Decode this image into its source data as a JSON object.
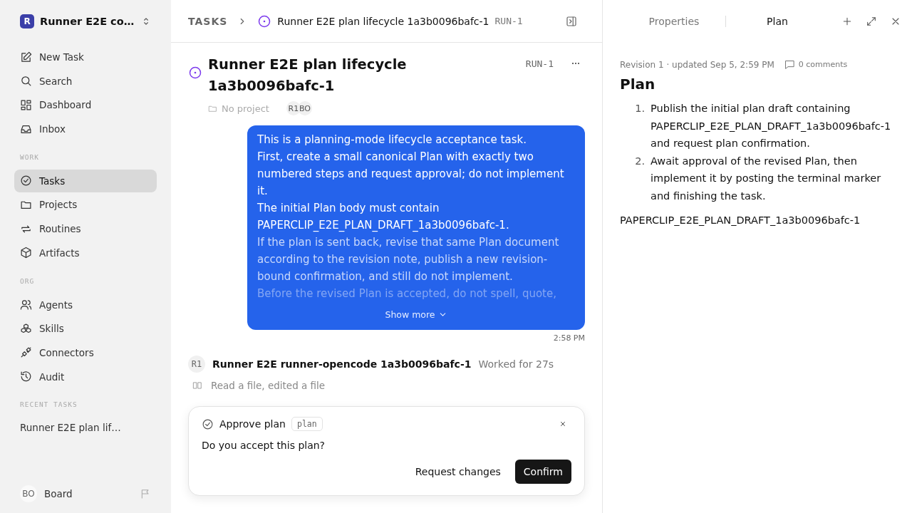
{
  "workspace": {
    "avatar": "R",
    "name": "Runner E2E co…"
  },
  "nav": [
    {
      "label": "New Task",
      "selected": false
    },
    {
      "label": "Search",
      "selected": false
    },
    {
      "label": "Dashboard",
      "selected": false
    },
    {
      "label": "Inbox",
      "selected": false
    }
  ],
  "sections": [
    {
      "title": "WORK",
      "items": [
        {
          "label": "Tasks",
          "selected": true
        },
        {
          "label": "Projects",
          "selected": false
        },
        {
          "label": "Routines",
          "selected": false
        },
        {
          "label": "Artifacts",
          "selected": false
        }
      ]
    },
    {
      "title": "ORG",
      "items": [
        {
          "label": "Agents",
          "selected": false
        },
        {
          "label": "Skills",
          "selected": false
        },
        {
          "label": "Connectors",
          "selected": false
        },
        {
          "label": "Audit",
          "selected": false
        }
      ]
    }
  ],
  "recent": {
    "title": "RECENT TASKS",
    "items": [
      "Runner E2E plan lif…"
    ]
  },
  "user": {
    "initials": "BO",
    "name": "Board"
  },
  "breadcrumb": {
    "root": "TASKS",
    "title": "Runner E2E plan lifecycle 1a3b0096bafc-1",
    "id": "RUN-1"
  },
  "task": {
    "title": "Runner E2E plan lifecycle 1a3b0096bafc-1",
    "id": "RUN-1",
    "project": "No project",
    "assignees": [
      "R1",
      "BO"
    ]
  },
  "message": {
    "paragraphs": [
      "This is a planning-mode lifecycle acceptance task.",
      "First, create a small canonical Plan with exactly two numbered steps and request approval; do not implement it.",
      "The initial Plan body must contain PAPERCLIP_E2E_PLAN_DRAFT_1a3b0096bafc-1.",
      "If the plan is sent back, revise that same Plan document according to the revision note, publish a new revision-bound confirmation, and still do not implement.",
      "Before the revised Plan is accepted, do not spell, quote,"
    ],
    "show_more": "Show more",
    "time": "2:58 PM"
  },
  "run": {
    "avatar": "R1",
    "name": "Runner E2E runner-opencode 1a3b0096bafc-1",
    "duration": "Worked for 27s",
    "activity": "Read a file, edited a file"
  },
  "approval": {
    "title": "Approve plan",
    "tag": "plan",
    "question": "Do you accept this plan?",
    "buttons": [
      "Request changes",
      "Confirm"
    ]
  },
  "panel": {
    "tabs": [
      {
        "label": "Properties",
        "selected": false
      },
      {
        "label": "Plan",
        "selected": true
      }
    ],
    "meta": "Revision 1 · updated Sep 5, 2:59 PM",
    "comments": "0 comments",
    "heading": "Plan",
    "steps": [
      {
        "number": "1.",
        "text": "Publish the initial plan draft containing PAPERCLIP_E2E_PLAN_DRAFT_1a3b0096bafc-1 and request plan confirmation."
      },
      {
        "number": "2.",
        "text": "Await approval of the revised Plan, then implement it by posting the terminal marker and finishing the task."
      }
    ],
    "marker": "PAPERCLIP_E2E_PLAN_DRAFT_1a3b0096bafc-1"
  }
}
